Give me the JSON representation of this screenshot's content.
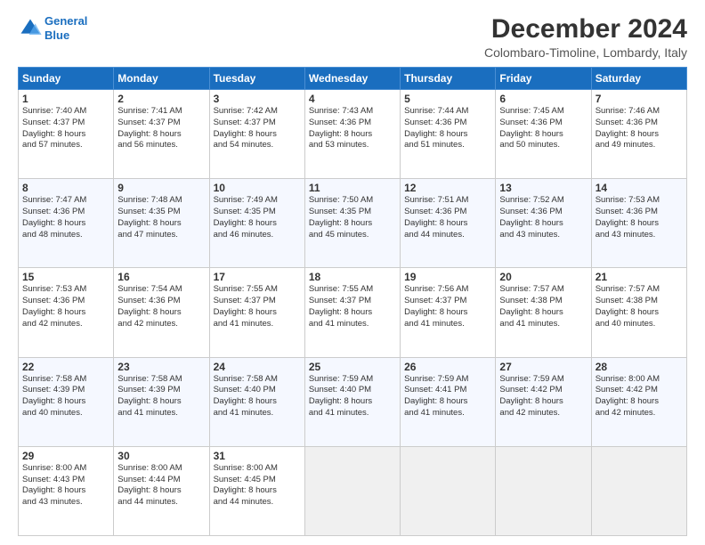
{
  "header": {
    "logo_line1": "General",
    "logo_line2": "Blue",
    "month_title": "December 2024",
    "location": "Colombaro-Timoline, Lombardy, Italy"
  },
  "weekdays": [
    "Sunday",
    "Monday",
    "Tuesday",
    "Wednesday",
    "Thursday",
    "Friday",
    "Saturday"
  ],
  "weeks": [
    [
      {
        "day": "1",
        "sunrise": "7:40 AM",
        "sunset": "4:37 PM",
        "daylight": "8 hours and 57 minutes."
      },
      {
        "day": "2",
        "sunrise": "7:41 AM",
        "sunset": "4:37 PM",
        "daylight": "8 hours and 56 minutes."
      },
      {
        "day": "3",
        "sunrise": "7:42 AM",
        "sunset": "4:37 PM",
        "daylight": "8 hours and 54 minutes."
      },
      {
        "day": "4",
        "sunrise": "7:43 AM",
        "sunset": "4:36 PM",
        "daylight": "8 hours and 53 minutes."
      },
      {
        "day": "5",
        "sunrise": "7:44 AM",
        "sunset": "4:36 PM",
        "daylight": "8 hours and 51 minutes."
      },
      {
        "day": "6",
        "sunrise": "7:45 AM",
        "sunset": "4:36 PM",
        "daylight": "8 hours and 50 minutes."
      },
      {
        "day": "7",
        "sunrise": "7:46 AM",
        "sunset": "4:36 PM",
        "daylight": "8 hours and 49 minutes."
      }
    ],
    [
      {
        "day": "8",
        "sunrise": "7:47 AM",
        "sunset": "4:36 PM",
        "daylight": "8 hours and 48 minutes."
      },
      {
        "day": "9",
        "sunrise": "7:48 AM",
        "sunset": "4:35 PM",
        "daylight": "8 hours and 47 minutes."
      },
      {
        "day": "10",
        "sunrise": "7:49 AM",
        "sunset": "4:35 PM",
        "daylight": "8 hours and 46 minutes."
      },
      {
        "day": "11",
        "sunrise": "7:50 AM",
        "sunset": "4:35 PM",
        "daylight": "8 hours and 45 minutes."
      },
      {
        "day": "12",
        "sunrise": "7:51 AM",
        "sunset": "4:36 PM",
        "daylight": "8 hours and 44 minutes."
      },
      {
        "day": "13",
        "sunrise": "7:52 AM",
        "sunset": "4:36 PM",
        "daylight": "8 hours and 43 minutes."
      },
      {
        "day": "14",
        "sunrise": "7:53 AM",
        "sunset": "4:36 PM",
        "daylight": "8 hours and 43 minutes."
      }
    ],
    [
      {
        "day": "15",
        "sunrise": "7:53 AM",
        "sunset": "4:36 PM",
        "daylight": "8 hours and 42 minutes."
      },
      {
        "day": "16",
        "sunrise": "7:54 AM",
        "sunset": "4:36 PM",
        "daylight": "8 hours and 42 minutes."
      },
      {
        "day": "17",
        "sunrise": "7:55 AM",
        "sunset": "4:37 PM",
        "daylight": "8 hours and 41 minutes."
      },
      {
        "day": "18",
        "sunrise": "7:55 AM",
        "sunset": "4:37 PM",
        "daylight": "8 hours and 41 minutes."
      },
      {
        "day": "19",
        "sunrise": "7:56 AM",
        "sunset": "4:37 PM",
        "daylight": "8 hours and 41 minutes."
      },
      {
        "day": "20",
        "sunrise": "7:57 AM",
        "sunset": "4:38 PM",
        "daylight": "8 hours and 41 minutes."
      },
      {
        "day": "21",
        "sunrise": "7:57 AM",
        "sunset": "4:38 PM",
        "daylight": "8 hours and 40 minutes."
      }
    ],
    [
      {
        "day": "22",
        "sunrise": "7:58 AM",
        "sunset": "4:39 PM",
        "daylight": "8 hours and 40 minutes."
      },
      {
        "day": "23",
        "sunrise": "7:58 AM",
        "sunset": "4:39 PM",
        "daylight": "8 hours and 41 minutes."
      },
      {
        "day": "24",
        "sunrise": "7:58 AM",
        "sunset": "4:40 PM",
        "daylight": "8 hours and 41 minutes."
      },
      {
        "day": "25",
        "sunrise": "7:59 AM",
        "sunset": "4:40 PM",
        "daylight": "8 hours and 41 minutes."
      },
      {
        "day": "26",
        "sunrise": "7:59 AM",
        "sunset": "4:41 PM",
        "daylight": "8 hours and 41 minutes."
      },
      {
        "day": "27",
        "sunrise": "7:59 AM",
        "sunset": "4:42 PM",
        "daylight": "8 hours and 42 minutes."
      },
      {
        "day": "28",
        "sunrise": "8:00 AM",
        "sunset": "4:42 PM",
        "daylight": "8 hours and 42 minutes."
      }
    ],
    [
      {
        "day": "29",
        "sunrise": "8:00 AM",
        "sunset": "4:43 PM",
        "daylight": "8 hours and 43 minutes."
      },
      {
        "day": "30",
        "sunrise": "8:00 AM",
        "sunset": "4:44 PM",
        "daylight": "8 hours and 44 minutes."
      },
      {
        "day": "31",
        "sunrise": "8:00 AM",
        "sunset": "4:45 PM",
        "daylight": "8 hours and 44 minutes."
      },
      null,
      null,
      null,
      null
    ]
  ]
}
